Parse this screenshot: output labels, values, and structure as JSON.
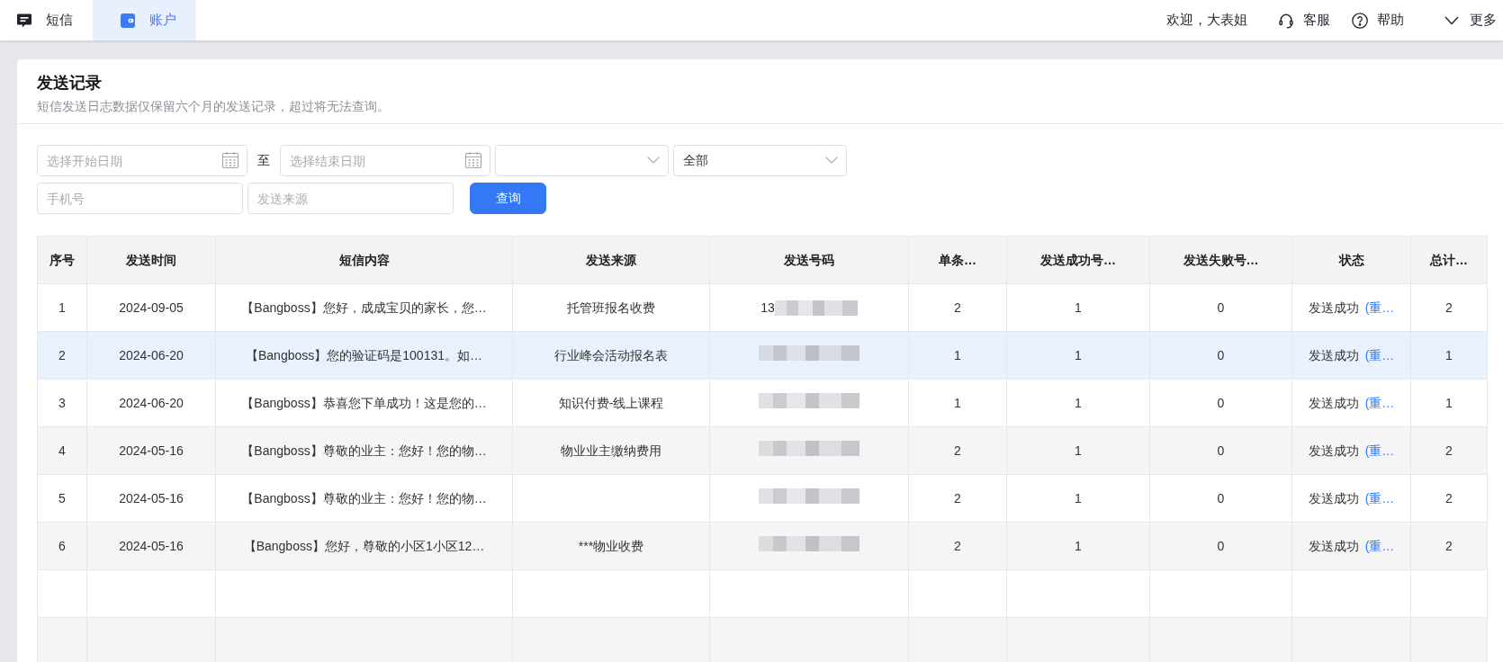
{
  "nav": {
    "tabs": [
      {
        "label": "短信",
        "kind": "messages",
        "selected": false
      },
      {
        "label": "账户",
        "kind": "account",
        "selected": true
      }
    ],
    "welcome": "欢迎，大表姐",
    "links": [
      {
        "label": "客服",
        "kind": "service"
      },
      {
        "label": "帮助",
        "kind": "help"
      },
      {
        "label": "更多",
        "kind": "more"
      }
    ]
  },
  "page": {
    "title": "发送记录",
    "subtitle": "短信发送日志数据仅保留六个月的发送记录，超过将无法查询。"
  },
  "filters": {
    "rows": [
      [
        {
          "kind": "date",
          "placeholder": "选择开始日期"
        },
        {
          "kind": "separator",
          "text": "至"
        },
        {
          "kind": "date",
          "placeholder": "选择结束日期"
        },
        {
          "kind": "select"
        },
        {
          "kind": "select",
          "value": "全部"
        }
      ],
      [
        {
          "kind": "input",
          "placeholder": "手机号"
        },
        {
          "kind": "input",
          "placeholder": "发送来源"
        },
        {
          "kind": "button",
          "label": "查询"
        }
      ]
    ]
  },
  "table": {
    "columns": [
      "序号",
      "发送时间",
      "短信内容",
      "发送来源",
      "发送号码",
      "单条…",
      "发送成功号…",
      "发送失败号…",
      "状态",
      "总计…"
    ],
    "rows": [
      {
        "selected": false,
        "no": "1",
        "time": "2024-09-05",
        "content": "【Bangboss】您好，成成宝贝的家长，您…",
        "source": "托管班报名收费",
        "phone": "13",
        "phone_masked": true,
        "per_count": "2",
        "success": "1",
        "failed": "0",
        "status": "发送成功",
        "action": "(重…",
        "total": "2"
      },
      {
        "selected": true,
        "no": "2",
        "time": "2024-06-20",
        "content": "【Bangboss】您的验证码是100131。如…",
        "source": "行业峰会活动报名表",
        "phone_masked": true,
        "per_count": "1",
        "success": "1",
        "failed": "0",
        "status": "发送成功",
        "action": "(重…",
        "total": "1"
      },
      {
        "selected": false,
        "no": "3",
        "time": "2024-06-20",
        "content": "【Bangboss】恭喜您下单成功！这是您的…",
        "source": "知识付费-线上课程",
        "phone_masked": true,
        "per_count": "1",
        "success": "1",
        "failed": "0",
        "status": "发送成功",
        "action": "(重…",
        "total": "1"
      },
      {
        "selected": false,
        "no": "4",
        "time": "2024-05-16",
        "content": "【Bangboss】尊敬的业主：您好！您的物…",
        "source": "物业业主缴纳费用",
        "phone_masked": true,
        "per_count": "2",
        "success": "1",
        "failed": "0",
        "status": "发送成功",
        "action": "(重…",
        "total": "2"
      },
      {
        "selected": false,
        "no": "5",
        "time": "2024-05-16",
        "content": "【Bangboss】尊敬的业主：您好！您的物…",
        "phone_masked": true,
        "per_count": "2",
        "success": "1",
        "failed": "0",
        "status": "发送成功",
        "action": "(重…",
        "total": "2"
      },
      {
        "selected": false,
        "no": "6",
        "time": "2024-05-16",
        "content": "【Bangboss】您好，尊敬的小区1小区12…",
        "source": "***物业收费",
        "phone_masked": true,
        "per_count": "2",
        "success": "1",
        "failed": "0",
        "status": "发送成功",
        "action": "(重…",
        "total": "2"
      }
    ]
  }
}
